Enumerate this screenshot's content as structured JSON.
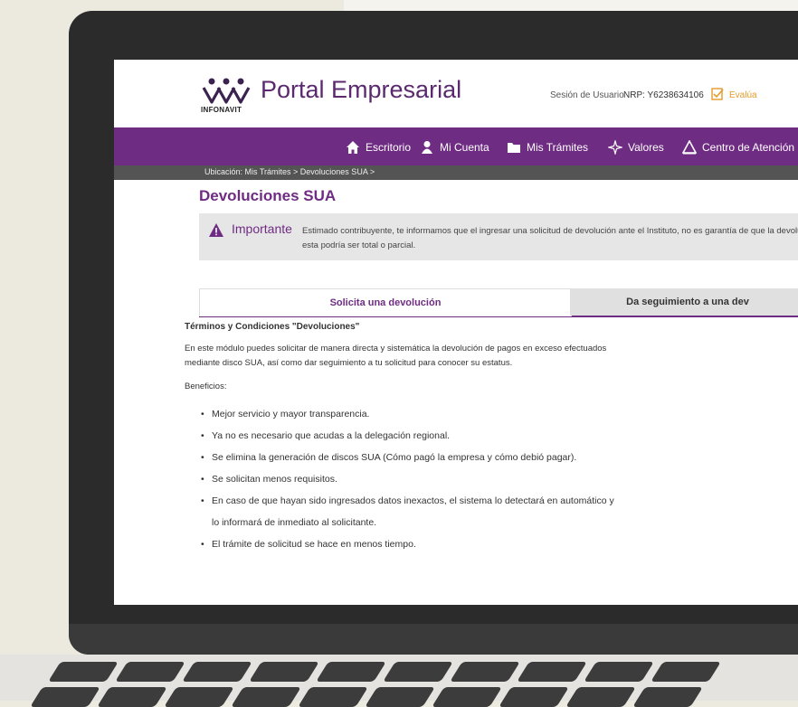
{
  "header": {
    "logo_text": "INFONAVIT",
    "portal_title": "Portal Empresarial",
    "session_link": "Sesión de Usuario",
    "nrp": "NRP: Y6238634106",
    "evalua": "Evalúa"
  },
  "nav": {
    "items": [
      {
        "label": "Escritorio",
        "icon": "home-icon"
      },
      {
        "label": "Mi Cuenta",
        "icon": "user-icon"
      },
      {
        "label": "Mis Trámites",
        "icon": "folder-icon"
      },
      {
        "label": "Valores",
        "icon": "sparkle-icon"
      },
      {
        "label": "Centro de Atención Em",
        "icon": "warning-icon"
      }
    ]
  },
  "breadcrumb": "Ubicación: Mis Trámites > Devoluciones SUA >",
  "page_title": "Devoluciones SUA",
  "notice": {
    "title": "Importante",
    "text_line1": "Estimado contribuyente, te informamos que el ingresar una solicitud de devolución ante el Instituto, no es garantía de que la devolución se",
    "text_line2": "esta podría ser total o parcial."
  },
  "tabs": [
    {
      "label": "Solicita una devolución",
      "active": true
    },
    {
      "label": "Da seguimiento a una dev",
      "active": false
    }
  ],
  "content": {
    "terms_title": "Términos y Condiciones \"Devoluciones\"",
    "intro_line1": "En este módulo puedes solicitar de manera directa y sistemática la devolución de pagos en exceso efectuados",
    "intro_line2": "mediante disco SUA, así como dar seguimiento a tu solicitud para conocer su estatus.",
    "benefits_label": "Beneficios:",
    "benefits": [
      "Mejor servicio y mayor transparencia.",
      "Ya no es necesario que acudas a la delegación regional.",
      "Se elimina la generación de discos SUA (Cómo pagó la empresa y cómo debió pagar).",
      "Se solicitan menos requisitos.",
      "En caso de que hayan sido ingresados datos inexactos, el sistema lo detectará en automático y",
      "lo informará de inmediato al solicitante.",
      "El trámite de solicitud se hace en menos tiempo."
    ]
  },
  "colors": {
    "brand_purple": "#6f2c83",
    "accent_orange": "#e59a2a",
    "breadcrumb_bg": "#545454"
  }
}
